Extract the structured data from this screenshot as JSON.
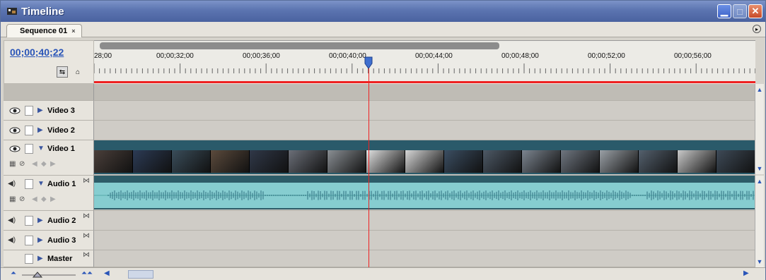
{
  "window": {
    "title": "Timeline"
  },
  "tab": {
    "label": "Sequence 01",
    "close_glyph": "×"
  },
  "header": {
    "timecode": "00;00;40;22"
  },
  "ruler": {
    "labels": [
      "28;00",
      "00;00;32;00",
      "00;00;36;00",
      "00;00;40;00",
      "00;00;44;00",
      "00;00;48;00",
      "00;00;52;00",
      "00;00;56;00"
    ]
  },
  "tracks": {
    "video3": "Video 3",
    "video2": "Video 2",
    "video1": "Video 1",
    "audio1": "Audio 1",
    "audio2": "Audio 2",
    "audio3": "Audio 3",
    "master": "Master"
  },
  "colors": {
    "playhead": "#e22222",
    "timecode": "#2a55b8",
    "video_clip_bar": "#2a5a6a",
    "audio_wave": "#7fc6c8"
  }
}
